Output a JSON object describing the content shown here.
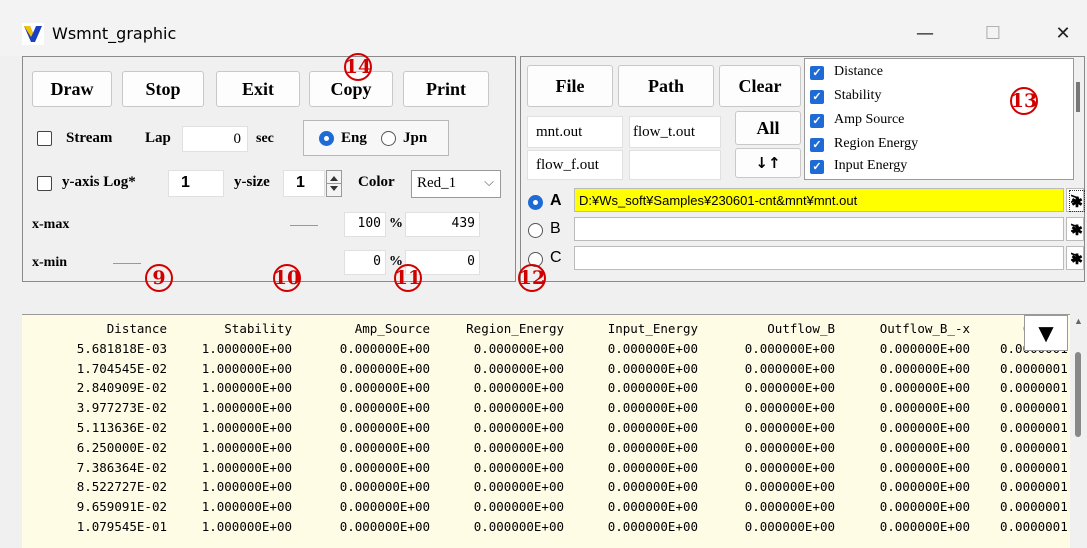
{
  "window": {
    "title": "Wsmnt_graphic",
    "minimize": "—",
    "maximize": "☐",
    "close": "✕"
  },
  "controls": {
    "buttons": [
      "Draw",
      "Stop",
      "Exit",
      "Copy",
      "Print"
    ],
    "stream_label": "Stream",
    "lap_label": "Lap",
    "lap_value": "0",
    "sec_label": "sec",
    "lang_eng": "Eng",
    "lang_jpn": "Jpn",
    "yaxis_log_label": "y-axis Log*",
    "yaxis_log_value": "1",
    "ysize_label": "y-size",
    "ysize_value": "1",
    "color_label": "Color",
    "color_value": "Red_1",
    "xmax_label": "x-max",
    "xmax_percent": "100",
    "xmax_value": "439",
    "xmin_label": "x-min",
    "xmin_percent": "0",
    "xmin_value": "0",
    "percent_sign": "%"
  },
  "files": {
    "file_button": "File",
    "path_button": "Path",
    "clear_button": "Clear",
    "all_button": "All",
    "sort_button": "↓↑",
    "file1": "mnt.out",
    "file2": "flow_t.out",
    "file3": "flow_f.out",
    "file4": "",
    "checklist": [
      "Distance",
      "Stability",
      "Amp Source",
      "Region Energy",
      "Input Energy"
    ],
    "paths": [
      {
        "label": "A",
        "value": "D:¥Ws_soft¥Samples¥230601-cnt&mnt¥mnt.out",
        "selected": true
      },
      {
        "label": "B",
        "value": "",
        "selected": false
      },
      {
        "label": "C",
        "value": "",
        "selected": false
      }
    ],
    "arrow": ">",
    "star": "✱"
  },
  "annotations": {
    "n9": "9",
    "n10": "10",
    "n11": "11",
    "n12": "12",
    "n13": "13",
    "n14": "14",
    "color": "#d00000"
  },
  "table": {
    "headers": [
      "Distance",
      "Stability",
      "Amp_Source",
      "Region_Energy",
      "Input_Energy",
      "Outflow_B",
      "Outflow_B_-x",
      "Out"
    ],
    "rows": [
      [
        "5.681818E-03",
        "1.000000E+00",
        "0.000000E+00",
        "0.000000E+00",
        "0.000000E+00",
        "0.000000E+00",
        "0.000000E+00",
        "0.0000001"
      ],
      [
        "1.704545E-02",
        "1.000000E+00",
        "0.000000E+00",
        "0.000000E+00",
        "0.000000E+00",
        "0.000000E+00",
        "0.000000E+00",
        "0.0000001"
      ],
      [
        "2.840909E-02",
        "1.000000E+00",
        "0.000000E+00",
        "0.000000E+00",
        "0.000000E+00",
        "0.000000E+00",
        "0.000000E+00",
        "0.0000001"
      ],
      [
        "3.977273E-02",
        "1.000000E+00",
        "0.000000E+00",
        "0.000000E+00",
        "0.000000E+00",
        "0.000000E+00",
        "0.000000E+00",
        "0.0000001"
      ],
      [
        "5.113636E-02",
        "1.000000E+00",
        "0.000000E+00",
        "0.000000E+00",
        "0.000000E+00",
        "0.000000E+00",
        "0.000000E+00",
        "0.0000001"
      ],
      [
        "6.250000E-02",
        "1.000000E+00",
        "0.000000E+00",
        "0.000000E+00",
        "0.000000E+00",
        "0.000000E+00",
        "0.000000E+00",
        "0.0000001"
      ],
      [
        "7.386364E-02",
        "1.000000E+00",
        "0.000000E+00",
        "0.000000E+00",
        "0.000000E+00",
        "0.000000E+00",
        "0.000000E+00",
        "0.0000001"
      ],
      [
        "8.522727E-02",
        "1.000000E+00",
        "0.000000E+00",
        "0.000000E+00",
        "0.000000E+00",
        "0.000000E+00",
        "0.000000E+00",
        "0.0000001"
      ],
      [
        "9.659091E-02",
        "1.000000E+00",
        "0.000000E+00",
        "0.000000E+00",
        "0.000000E+00",
        "0.000000E+00",
        "0.000000E+00",
        "0.0000001"
      ],
      [
        "1.079545E-01",
        "1.000000E+00",
        "0.000000E+00",
        "0.000000E+00",
        "0.000000E+00",
        "0.000000E+00",
        "0.000000E+00",
        "0.0000001"
      ]
    ],
    "scroll_button": "▼"
  }
}
